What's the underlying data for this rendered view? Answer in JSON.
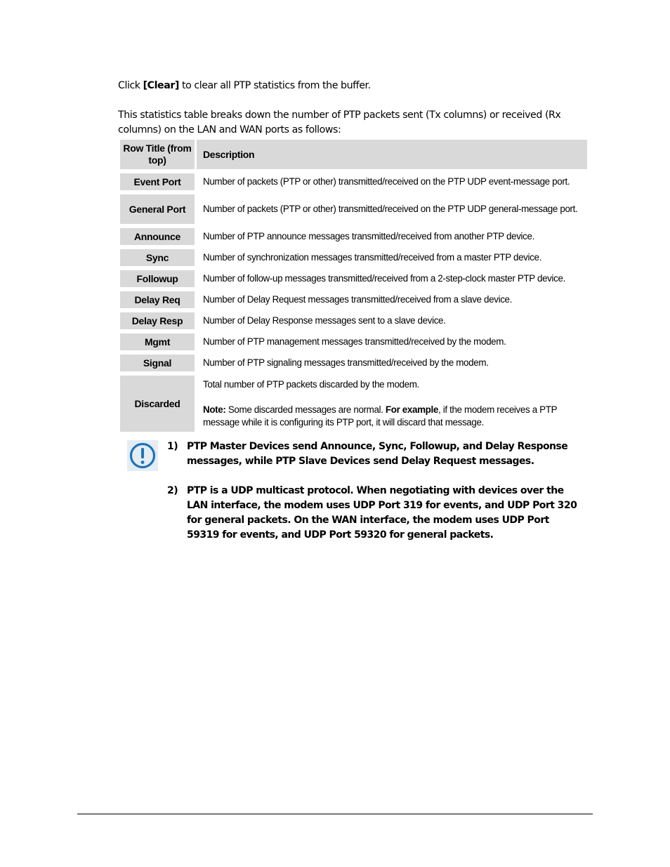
{
  "intro": {
    "p1_prefix": "Click ",
    "p1_button": "[Clear]",
    "p1_suffix": " to clear all PTP statistics from the buffer.",
    "p2": "This statistics table breaks down the number of PTP packets sent (Tx columns) or received (Rx columns) on the LAN and WAN ports as follows:"
  },
  "table": {
    "headers": {
      "row_title": "Row Title (from top)",
      "description": "Description"
    },
    "rows": [
      {
        "title": "Event Port",
        "description": "Number of packets (PTP or other) transmitted/received on the PTP UDP event-message port."
      },
      {
        "title": "General Port",
        "description": "Number of packets (PTP or other) transmitted/received on the PTP UDP general-message port."
      },
      {
        "title": "Announce",
        "description": "Number of PTP announce messages transmitted/received from another PTP device."
      },
      {
        "title": "Sync",
        "description": "Number of synchronization messages transmitted/received from a master PTP device."
      },
      {
        "title": "Followup",
        "description": "Number of follow-up messages transmitted/received from a 2-step-clock master PTP device."
      },
      {
        "title": "Delay Req",
        "description": "Number of Delay Request messages transmitted/received from a slave device."
      },
      {
        "title": "Delay Resp",
        "description": "Number of Delay Response messages sent to a slave device."
      },
      {
        "title": "Mgmt",
        "description": "Number of PTP management messages transmitted/received by the modem."
      },
      {
        "title": "Signal",
        "description": "Number of PTP signaling messages transmitted/received by the modem."
      },
      {
        "title": "Discarded",
        "description": "Total number of PTP packets discarded by the modem.",
        "note_label": "Note:",
        "note_text_1": " Some discarded messages are normal. ",
        "note_example_label": "For example",
        "note_text_2": ", if the modem receives a PTP message while it is configuring its PTP port, it will discard that message."
      }
    ]
  },
  "notes": {
    "icon": "exclamation-circle-icon",
    "icon_color": "#1f73b7",
    "items": [
      {
        "number": "1)",
        "text": "PTP Master Devices send Announce, Sync, Followup, and Delay Response messages, while PTP Slave Devices send Delay Request messages."
      },
      {
        "number": "2)",
        "text": "PTP is a UDP multicast protocol. When negotiating with devices over the LAN interface, the modem uses UDP Port 319 for events, and UDP Port 320 for general packets. On the WAN interface, the modem uses UDP Port 59319 for events, and UDP Port 59320 for general packets."
      }
    ]
  }
}
